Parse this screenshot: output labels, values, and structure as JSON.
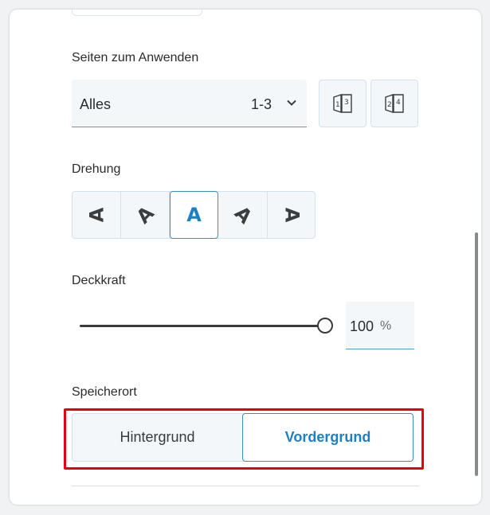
{
  "pages_section": {
    "label": "Seiten zum Anwenden",
    "selected_value": "Alles",
    "range": "1-3",
    "buttons": [
      {
        "icon": "odd-pages-icon"
      },
      {
        "icon": "even-pages-icon"
      }
    ]
  },
  "rotation_section": {
    "label": "Drehung",
    "options": [
      {
        "glyph": "A",
        "icon": "rotate-left-90-icon"
      },
      {
        "glyph": "A",
        "icon": "rotate-left-45-icon"
      },
      {
        "glyph": "A",
        "icon": "rotate-0-icon",
        "active": true
      },
      {
        "glyph": "A",
        "icon": "rotate-right-45-icon"
      },
      {
        "glyph": "A",
        "icon": "rotate-right-90-icon"
      }
    ]
  },
  "opacity_section": {
    "label": "Deckkraft",
    "value": "100",
    "unit": "%",
    "slider_level": 1.0
  },
  "location_section": {
    "label": "Speicherort",
    "options": [
      "Hintergrund",
      "Vordergrund"
    ],
    "selected": "Vordergrund"
  },
  "colors": {
    "accent": "#1d7fc4",
    "highlight": "#e4000f"
  }
}
